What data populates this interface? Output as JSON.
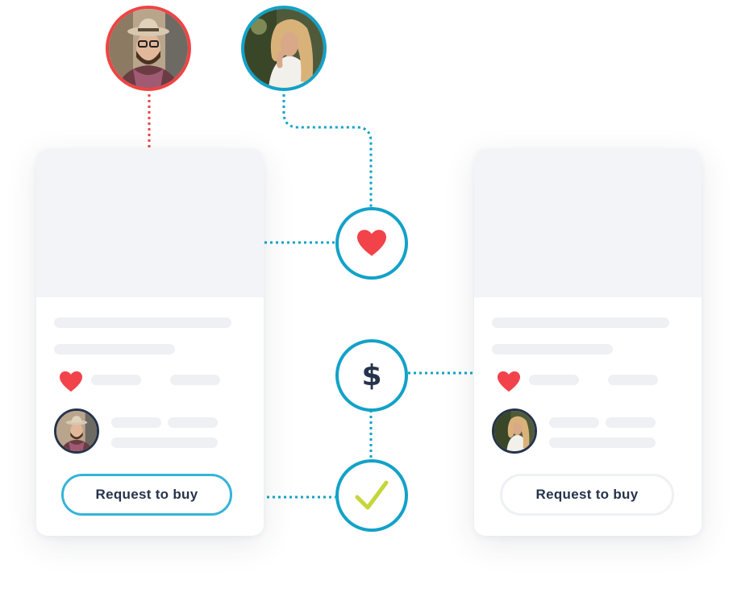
{
  "cards": [
    {
      "id": "buyer",
      "button_label": "Request to buy",
      "button_state": "active",
      "avatar": "man-with-hat-avatar"
    },
    {
      "id": "seller",
      "button_label": "Request to buy",
      "button_state": "inactive",
      "avatar": "blonde-woman-avatar"
    }
  ],
  "nodes": {
    "like": "heart-icon",
    "pay": "dollar-icon",
    "done": "checkmark-icon"
  },
  "dollar_symbol": "$",
  "colors": {
    "red_dash": "#ef4444",
    "blue_dash": "#12a2c8",
    "heart": "#f2434a",
    "check": "#c5d63a",
    "navy": "#25334b",
    "button_active_border": "#35b4d8"
  }
}
